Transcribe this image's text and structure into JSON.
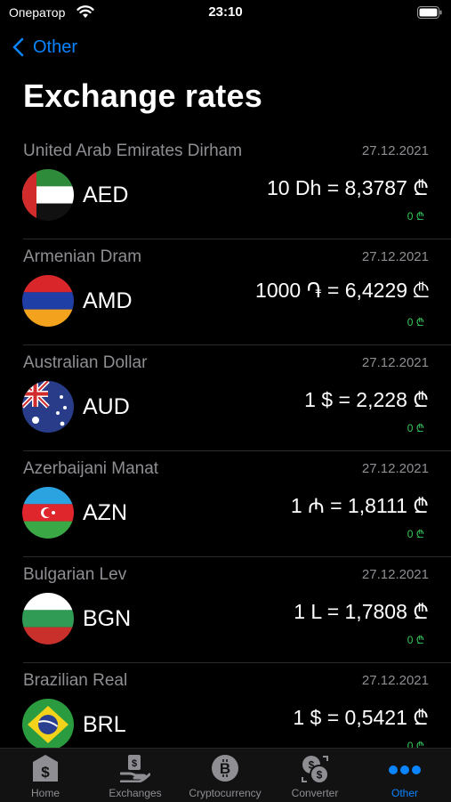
{
  "status_bar": {
    "carrier": "Оператор",
    "time": "23:10"
  },
  "nav": {
    "back_label": "Other"
  },
  "page": {
    "title": "Exchange rates"
  },
  "rates": [
    {
      "name": "United Arab Emirates Dirham",
      "date": "27.12.2021",
      "code": "AED",
      "rate": "10 Dh = 8,3787 ₾",
      "change": "0 ₾",
      "flag_icon": "uae-flag-icon"
    },
    {
      "name": "Armenian Dram",
      "date": "27.12.2021",
      "code": "AMD",
      "rate": "1000 ֏ = 6,4229 ₾",
      "change": "0 ₾",
      "flag_icon": "armenia-flag-icon"
    },
    {
      "name": "Australian Dollar",
      "date": "27.12.2021",
      "code": "AUD",
      "rate": "1 $ = 2,228 ₾",
      "change": "0 ₾",
      "flag_icon": "australia-flag-icon"
    },
    {
      "name": "Azerbaijani Manat",
      "date": "27.12.2021",
      "code": "AZN",
      "rate": "1 ₼ = 1,8111 ₾",
      "change": "0 ₾",
      "flag_icon": "azerbaijan-flag-icon"
    },
    {
      "name": "Bulgarian Lev",
      "date": "27.12.2021",
      "code": "BGN",
      "rate": "1 L = 1,7808 ₾",
      "change": "0 ₾",
      "flag_icon": "bulgaria-flag-icon"
    },
    {
      "name": "Brazilian Real",
      "date": "27.12.2021",
      "code": "BRL",
      "rate": "1 $ = 0,5421 ₾",
      "change": "0 ₾",
      "flag_icon": "brazil-flag-icon"
    }
  ],
  "tabs": [
    {
      "label": "Home",
      "icon": "bank-icon"
    },
    {
      "label": "Exchanges",
      "icon": "exchange-hand-icon"
    },
    {
      "label": "Cryptocurrency",
      "icon": "bitcoin-icon"
    },
    {
      "label": "Converter",
      "icon": "converter-icon"
    },
    {
      "label": "Other",
      "icon": "more-icon",
      "active": true
    }
  ],
  "colors": {
    "accent": "#0a84ff",
    "positive": "#34c759",
    "secondary_text": "#8e8e93",
    "background": "#000000"
  }
}
